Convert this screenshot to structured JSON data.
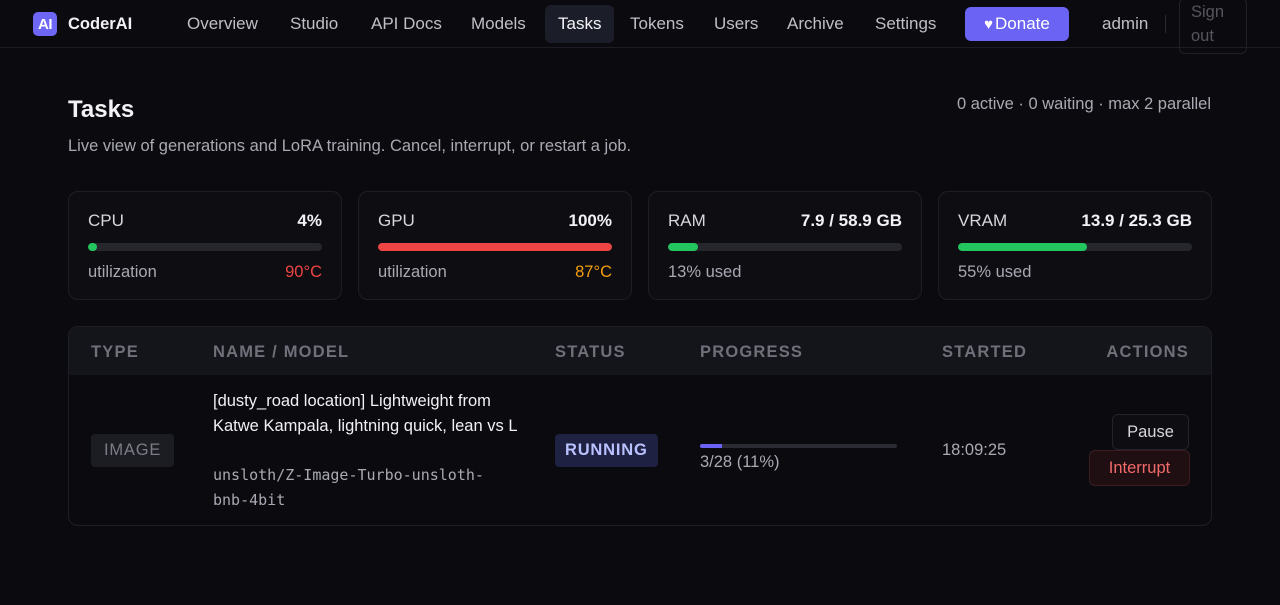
{
  "app": {
    "logo_mark": "AI",
    "name": "CoderAI"
  },
  "nav": {
    "items": [
      {
        "label": "Overview"
      },
      {
        "label": "Studio"
      },
      {
        "label": "API Docs"
      },
      {
        "label": "Models"
      },
      {
        "label": "Tasks",
        "active": true
      },
      {
        "label": "Tokens"
      },
      {
        "label": "Users"
      },
      {
        "label": "Archive"
      },
      {
        "label": "Settings"
      }
    ],
    "donate_icon": "heart-icon",
    "donate_heart": "♥",
    "donate_label": "Donate",
    "user": "admin",
    "signout_label": "Sign out"
  },
  "page": {
    "title": "Tasks",
    "subtitle": "Live view of generations and LoRA training. Cancel, interrupt, or restart a job.",
    "summary": "0 active · 0 waiting · max 2 parallel"
  },
  "metrics": [
    {
      "label": "CPU",
      "value": "4%",
      "percent": 4,
      "foot": "utilization",
      "temp": "90°C",
      "bar_color": "#22c55e",
      "temp_color": "#ef4444"
    },
    {
      "label": "GPU",
      "value": "100%",
      "percent": 100,
      "foot": "utilization",
      "temp": "87°C",
      "bar_color": "#ef4444",
      "temp_color": "#f59e0b"
    },
    {
      "label": "RAM",
      "value": "7.9 / 58.9 GB",
      "percent": 13,
      "foot": "13% used",
      "temp": "",
      "bar_color": "#22c55e",
      "temp_color": ""
    },
    {
      "label": "VRAM",
      "value": "13.9 / 25.3 GB",
      "percent": 55,
      "foot": "55% used",
      "temp": "",
      "bar_color": "#22c55e",
      "temp_color": ""
    }
  ],
  "table": {
    "columns": [
      "TYPE",
      "NAME / MODEL",
      "STATUS",
      "PROGRESS",
      "STARTED",
      "ACTIONS"
    ],
    "rows": [
      {
        "type": "IMAGE",
        "name": "[dusty_road location] Lightweight from Katwe Kampala, lightning quick, lean vs L",
        "model": "unsloth/Z-Image-Turbo-unsloth-bnb-4bit",
        "status": "RUNNING",
        "progress_fraction": 0.11,
        "progress_text": "3/28 (11%)",
        "started": "18:09:25",
        "actions": {
          "pause": "Pause",
          "interrupt": "Interrupt"
        }
      }
    ]
  }
}
